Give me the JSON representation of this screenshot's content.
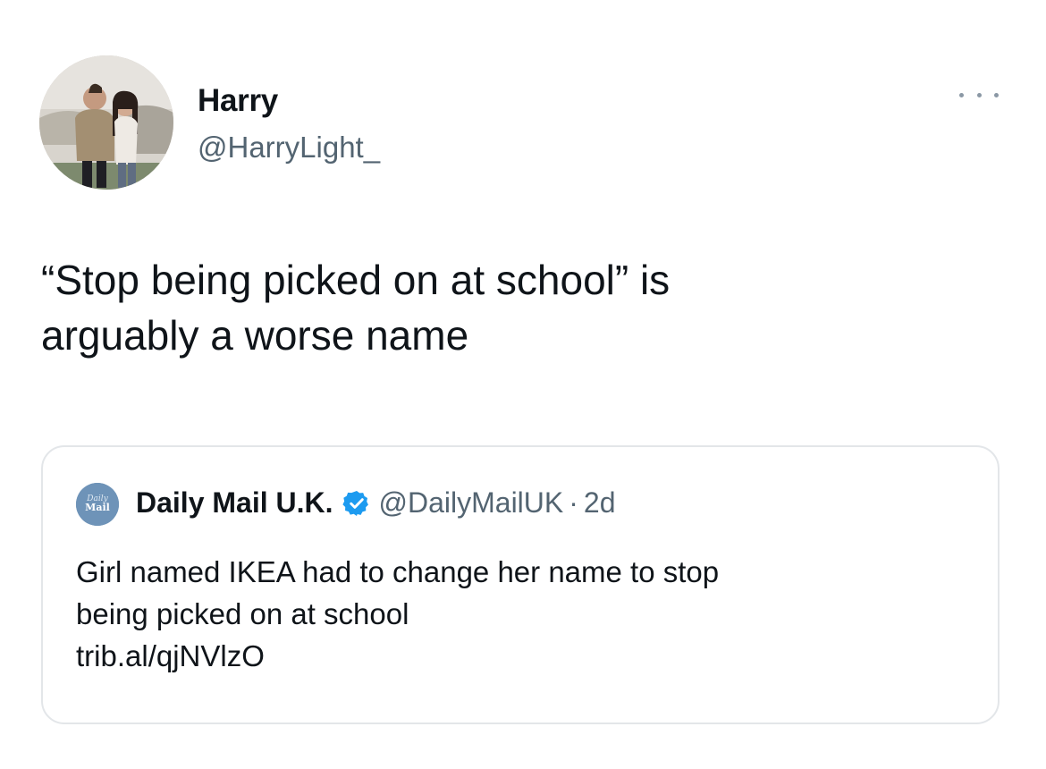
{
  "tweet": {
    "display_name": "Harry",
    "handle": "@HarryLight_",
    "text_line1": "“Stop being picked on at school” is",
    "text_line2": "arguably a worse name",
    "avatar_icon": "profile-photo-couple",
    "more_icon": "more-horizontal-icon"
  },
  "quoted": {
    "avatar_text_top": "Daily",
    "avatar_text_bottom": "Mail",
    "name": "Daily Mail U.K.",
    "verified_icon": "verified-badge-icon",
    "handle": "@DailyMailUK",
    "separator": "·",
    "time": "2d",
    "text_line1": "Girl named IKEA had to change her name to stop",
    "text_line2": "being picked on at school",
    "link": "trib.al/qjNVlzO"
  },
  "colors": {
    "text": "#0f1419",
    "secondary": "#536471",
    "border": "#e3e6e9",
    "verified": "#1d9bf0"
  }
}
